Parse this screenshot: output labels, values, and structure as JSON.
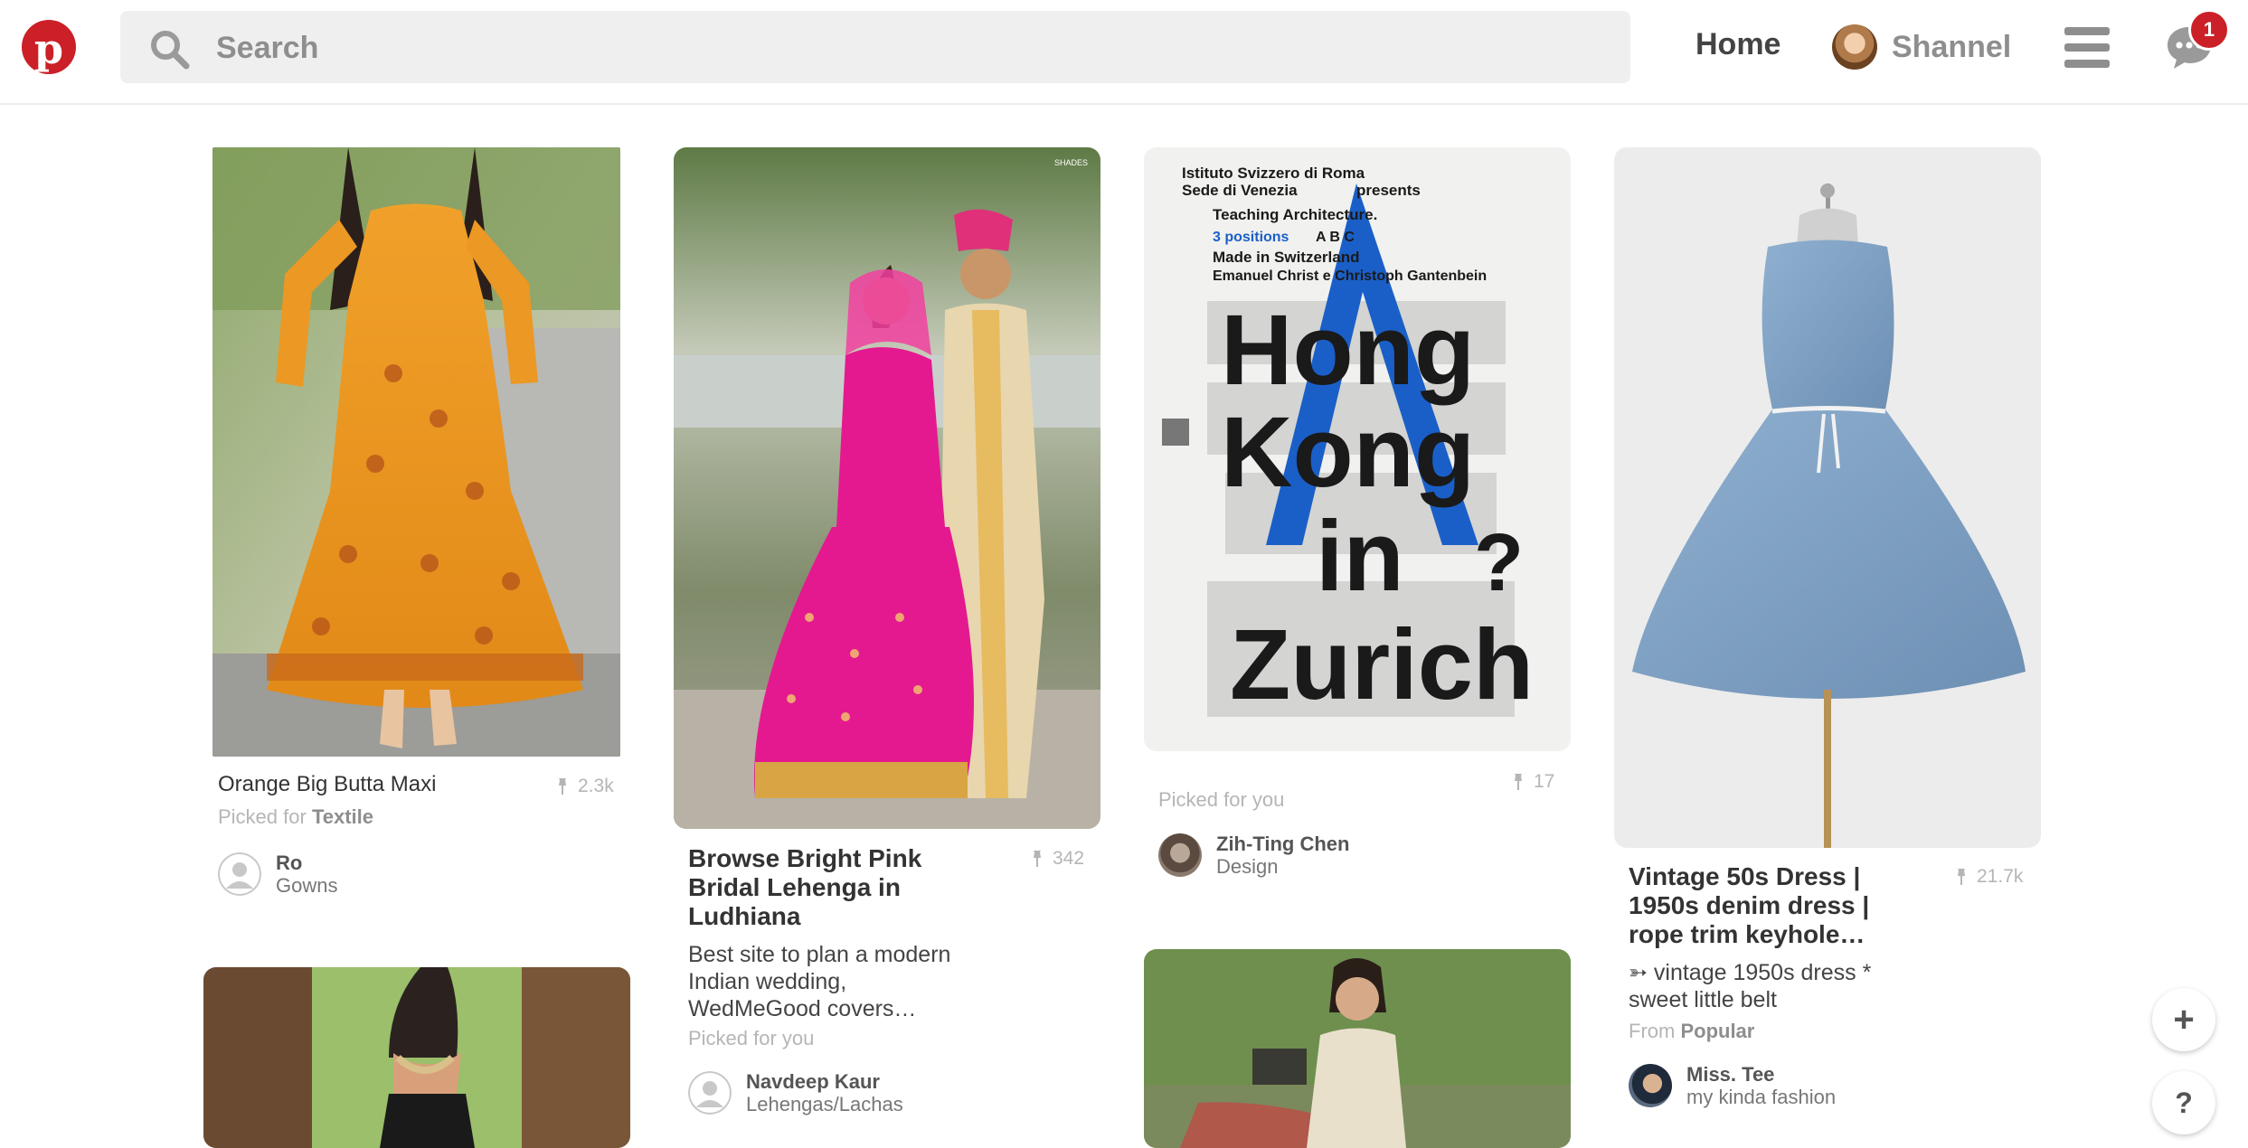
{
  "header": {
    "logo_letter": "p",
    "search_placeholder": "Search",
    "home_label": "Home",
    "profile_name": "Shannel",
    "messages_badge": "1"
  },
  "pins": [
    {
      "title": "Orange Big Butta Maxi",
      "repins": "2.3k",
      "picked_prefix": "Picked for",
      "picked_board": "Textile",
      "pinner_name": "Ro",
      "pinner_board": "Gowns"
    },
    {
      "watermark": "SHADES",
      "title": "Browse Bright Pink Bridal Lehenga in Ludhiana",
      "repins": "342",
      "description": "Best site to plan a modern Indian wedding, WedMeGood covers…",
      "picked": "Picked for you",
      "pinner_name": "Navdeep Kaur",
      "pinner_board": "Lehengas/Lachas"
    },
    {
      "poster": {
        "line1": "Istituto Svizzero di Roma",
        "line2": "Sede di Venezia",
        "line2b": "presents",
        "line3": "Teaching Architecture.",
        "line4": "3 positions",
        "line4b": "A B C",
        "line5": "Made in Switzerland",
        "line6": "Emanuel Christ e Christoph Gantenbein",
        "big1": "Hong",
        "big2": "Kong",
        "big3": "in",
        "big4": "Zurich",
        "qmark": "?"
      },
      "repins": "17",
      "picked": "Picked for you",
      "pinner_name": "Zih-Ting Chen",
      "pinner_board": "Design"
    },
    {
      "title": "Vintage 50s Dress | 1950s denim dress | rope trim keyhole…",
      "repins": "21.7k",
      "description": "➳ vintage 1950s dress * sweet little belt",
      "from_prefix": "From",
      "from_board": "Popular",
      "pinner_name": "Miss. Tee",
      "pinner_board": "my kinda fashion"
    }
  ],
  "fab": {
    "add": "+",
    "help": "?"
  }
}
